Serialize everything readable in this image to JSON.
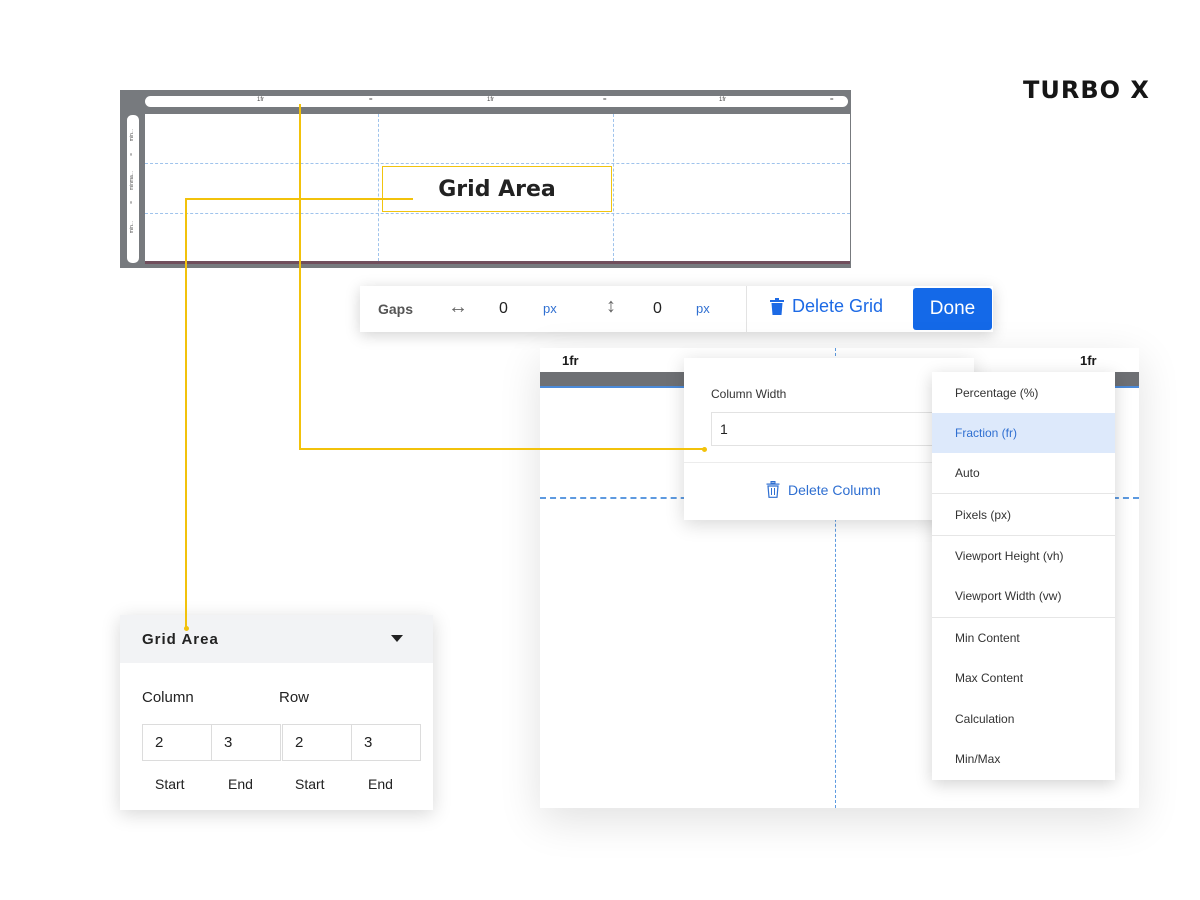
{
  "logo": "TURBO X",
  "grid_editor": {
    "top_ruler": [
      "1fr",
      "=",
      "1fr",
      "=",
      "1fr",
      "="
    ],
    "left_ruler": [
      "min...",
      "=",
      "minma...",
      "=",
      "min..."
    ],
    "grid_area_label": "Grid Area"
  },
  "toolbar": {
    "gaps_label": "Gaps",
    "horizontal_gap": "0",
    "horizontal_unit": "px",
    "vertical_gap": "0",
    "vertical_unit": "px",
    "delete_grid_label": "Delete Grid",
    "done_label": "Done"
  },
  "right_panel": {
    "ruler": [
      "1fr",
      "=",
      "1fr"
    ]
  },
  "column_popup": {
    "label": "Column Width",
    "value": "1",
    "delete_label": "Delete Column"
  },
  "unit_dropdown": {
    "selected": "Fraction (fr)",
    "items": [
      "Percentage (%)",
      "Fraction (fr)",
      "Auto",
      "Pixels (px)",
      "Viewport Height (vh)",
      "Viewport Width (vw)",
      "Min Content",
      "Max Content",
      "Calculation",
      "Min/Max"
    ]
  },
  "grid_area_panel": {
    "title": "Grid Area",
    "column_label": "Column",
    "row_label": "Row",
    "column_start": "2",
    "column_end": "3",
    "row_start": "2",
    "row_end": "3",
    "start_label": "Start",
    "end_label": "End"
  },
  "colors": {
    "accent": "#1469e8",
    "link": "#2f6fd1",
    "connector": "#f2c20b",
    "selected_bg": "#dde9fb"
  }
}
